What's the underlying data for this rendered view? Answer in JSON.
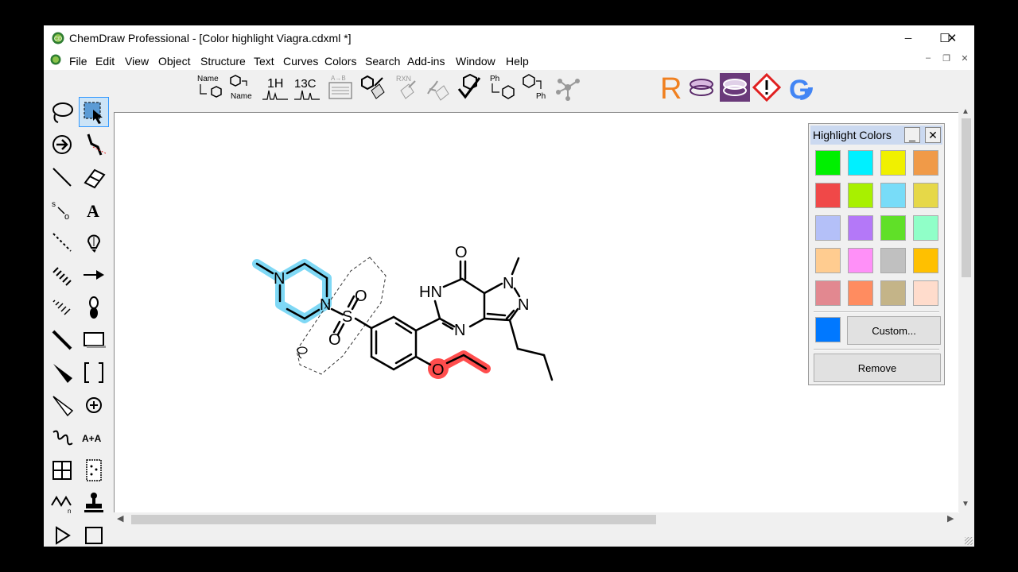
{
  "window": {
    "title": "ChemDraw Professional - [Color highlight Viagra.cdxml *]",
    "controls": {
      "minimize": "─",
      "maximize": "☐",
      "close": "✕"
    }
  },
  "menubar": {
    "items": [
      "File",
      "Edit",
      "View",
      "Object",
      "Structure",
      "Text",
      "Curves",
      "Colors",
      "Search",
      "Add-ins",
      "Window",
      "Help"
    ],
    "mdi_controls": {
      "minimize": "–",
      "restore": "❐",
      "close": "✕"
    }
  },
  "toolbar": {
    "buttons": [
      {
        "icon": "name-to-structure-icon",
        "label": "Name",
        "sub": ""
      },
      {
        "icon": "structure-to-name-icon",
        "label": "",
        "sub": "Name"
      },
      {
        "icon": "h1-nmr-icon",
        "label": "1H",
        "sub": ""
      },
      {
        "icon": "c13-nmr-icon",
        "label": "13C",
        "sub": ""
      },
      {
        "icon": "analysis-icon",
        "label": "A→B",
        "sub": ""
      },
      {
        "icon": "clean-structure-icon",
        "label": "",
        "sub": ""
      },
      {
        "icon": "clean-reaction-icon",
        "label": "RXN",
        "sub": ""
      },
      {
        "icon": "clean-biopolymer-icon",
        "label": "",
        "sub": ""
      },
      {
        "icon": "check-structure-icon",
        "label": "",
        "sub": ""
      },
      {
        "icon": "expand-label-icon",
        "label": "Ph",
        "sub": ""
      },
      {
        "icon": "contract-label-icon",
        "label": "",
        "sub": "Ph"
      },
      {
        "icon": "3d-model-icon",
        "label": "",
        "sub": ""
      }
    ],
    "addins": [
      "r-group-icon",
      "stack-icon",
      "stack-selected-icon",
      "hazard-icon",
      "google-icon"
    ],
    "r_letter": "R",
    "google_letter": "G"
  },
  "palette": {
    "tools": [
      [
        "lasso-icon",
        "marquee-select-icon"
      ],
      [
        "structure-perspective-icon",
        "chain-icon"
      ],
      [
        "solid-bond-icon",
        "eraser-icon"
      ],
      [
        "orbital-icon",
        "text-tool-icon"
      ],
      [
        "dashed-bond-icon",
        "pen-icon"
      ],
      [
        "hashed-bond-icon",
        "arrow-icon"
      ],
      [
        "hashed-wedge-icon",
        "orbital-lobe-icon"
      ],
      [
        "bold-bond-icon",
        "rectangle-icon"
      ],
      [
        "wedge-bond-icon",
        "brackets-icon"
      ],
      [
        "hollow-wedge-icon",
        "chemical-symbol-icon"
      ],
      [
        "wavy-bond-icon",
        "atom-map-icon"
      ],
      [
        "table-icon",
        "tlc-plate-icon"
      ],
      [
        "acyclic-chain-icon",
        "template-stamp-icon"
      ],
      [
        "play-icon",
        "square-ring-icon"
      ],
      [
        "pentagon-ring-icon",
        "hexagon-ring-icon"
      ]
    ],
    "text_tool": "A",
    "atom_map_label": "A+A"
  },
  "molecule": {
    "atoms": {
      "carbonyl_o": "O",
      "nh": "HN",
      "n_methyl": "N",
      "n_pyrazole": "N",
      "n_pyrimidine": "N",
      "s": "S",
      "so_top": "O",
      "so_bottom": "O",
      "piperazine_n1": "N",
      "piperazine_n2": "N",
      "ether_o": "O"
    },
    "highlights": {
      "piperazine": "#7fd8f5",
      "ethoxy": "#ff4d4d"
    }
  },
  "highlight_panel": {
    "title": "Highlight Colors",
    "minimize": "_",
    "close": "✕",
    "swatches": [
      "#00f000",
      "#00f0ff",
      "#f0f000",
      "#f09a48",
      "#f04848",
      "#a8f000",
      "#78dcf8",
      "#e6d848",
      "#b4c0f8",
      "#b478f8",
      "#60e028",
      "#90ffc8",
      "#ffcc90",
      "#ff90f8",
      "#c0c0c0",
      "#ffc000",
      "#e28890",
      "#ff8c60",
      "#c4b488",
      "#ffdccc"
    ],
    "selected_color": "#0078ff",
    "custom_label": "Custom...",
    "remove_label": "Remove"
  }
}
